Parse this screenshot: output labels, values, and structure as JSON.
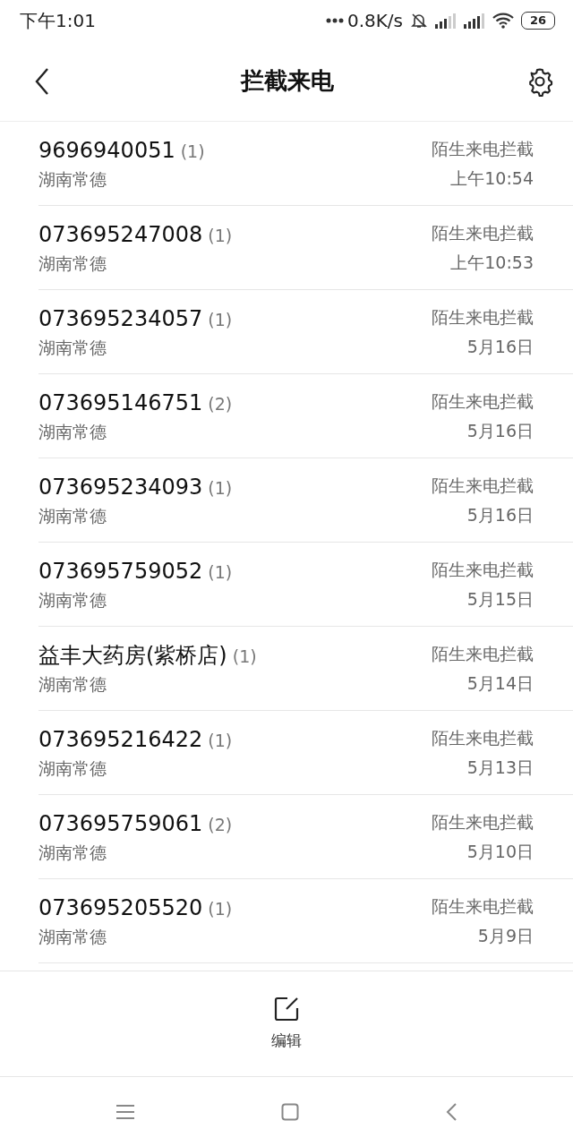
{
  "status_bar": {
    "time": "下午1:01",
    "speed": "0.8K/s",
    "battery": "26"
  },
  "header": {
    "title": "拦截来电"
  },
  "calls": [
    {
      "number": "9696940051",
      "count": "(1)",
      "location": "湖南常德",
      "type": "陌生来电拦截",
      "time": "上午10:54"
    },
    {
      "number": "073695247008",
      "count": "(1)",
      "location": "湖南常德",
      "type": "陌生来电拦截",
      "time": "上午10:53"
    },
    {
      "number": "073695234057",
      "count": "(1)",
      "location": "湖南常德",
      "type": "陌生来电拦截",
      "time": "5月16日"
    },
    {
      "number": "073695146751",
      "count": "(2)",
      "location": "湖南常德",
      "type": "陌生来电拦截",
      "time": "5月16日"
    },
    {
      "number": "073695234093",
      "count": "(1)",
      "location": "湖南常德",
      "type": "陌生来电拦截",
      "time": "5月16日"
    },
    {
      "number": "073695759052",
      "count": "(1)",
      "location": "湖南常德",
      "type": "陌生来电拦截",
      "time": "5月15日"
    },
    {
      "number": "益丰大药房(紫桥店)",
      "count": "(1)",
      "location": "湖南常德",
      "type": "陌生来电拦截",
      "time": "5月14日"
    },
    {
      "number": "073695216422",
      "count": "(1)",
      "location": "湖南常德",
      "type": "陌生来电拦截",
      "time": "5月13日"
    },
    {
      "number": "073695759061",
      "count": "(2)",
      "location": "湖南常德",
      "type": "陌生来电拦截",
      "time": "5月10日"
    },
    {
      "number": "073695205520",
      "count": "(1)",
      "location": "湖南常德",
      "type": "陌生来电拦截",
      "time": "5月9日"
    }
  ],
  "toolbar": {
    "edit_label": "编辑"
  }
}
